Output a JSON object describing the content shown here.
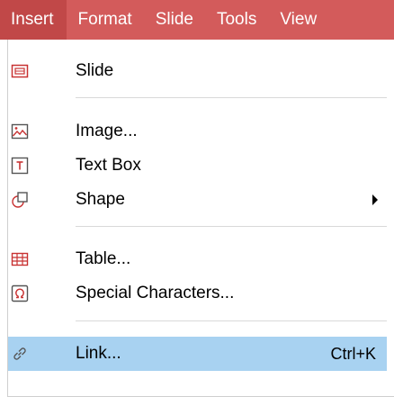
{
  "menubar": {
    "items": [
      "Insert",
      "Format",
      "Slide",
      "Tools",
      "View"
    ]
  },
  "menu": {
    "slide": {
      "label": "Slide"
    },
    "image": {
      "label": "Image..."
    },
    "text_box": {
      "label": "Text Box"
    },
    "shape": {
      "label": "Shape"
    },
    "table": {
      "label": "Table..."
    },
    "special_characters": {
      "label": "Special Characters..."
    },
    "link": {
      "label": "Link...",
      "shortcut": "Ctrl+K"
    }
  },
  "colors": {
    "menubar_bg": "#d35b5b",
    "menubar_active_bg": "#c14848",
    "highlight_bg": "#a8d2f1",
    "icon_red": "#c83232",
    "icon_gray": "#555555"
  }
}
